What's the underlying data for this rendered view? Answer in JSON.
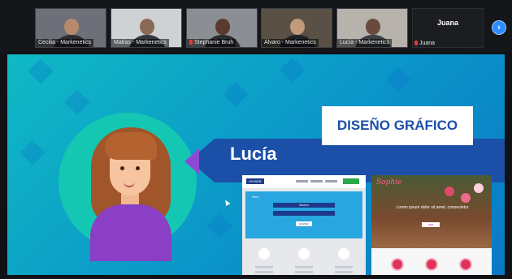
{
  "participants": [
    {
      "name": "Cecilia - Markenetics",
      "muted": false
    },
    {
      "name": "Matías - Markenetics",
      "muted": false
    },
    {
      "name": "Stephanie Bruh",
      "muted": true
    },
    {
      "name": "Álvaro - Markenetics",
      "muted": false
    },
    {
      "name": "Lucía - Markenetics",
      "muted": false
    }
  ],
  "active_speaker": {
    "label": "Juana",
    "name": "Juana",
    "muted": true
  },
  "next_page_icon": "chevron-right-icon",
  "slide": {
    "title": "DISEÑO GRÁFICO",
    "presenter_name": "Lucía",
    "mockup1": {
      "logo": "MYWEB",
      "hero_title": "Hero",
      "field_top": "Nuevo",
      "send_label": "ENVIAR"
    },
    "mockup2": {
      "logo": "Sophie",
      "headline": "Lorem ipsum dolor sit amet, consectetur",
      "cta": "VER"
    }
  },
  "colors": {
    "slide_bg": "#0fb9c4",
    "banner": "#1c4fa8",
    "accent_purple": "#8a3fc4",
    "zoom_blue": "#2d8cff"
  }
}
